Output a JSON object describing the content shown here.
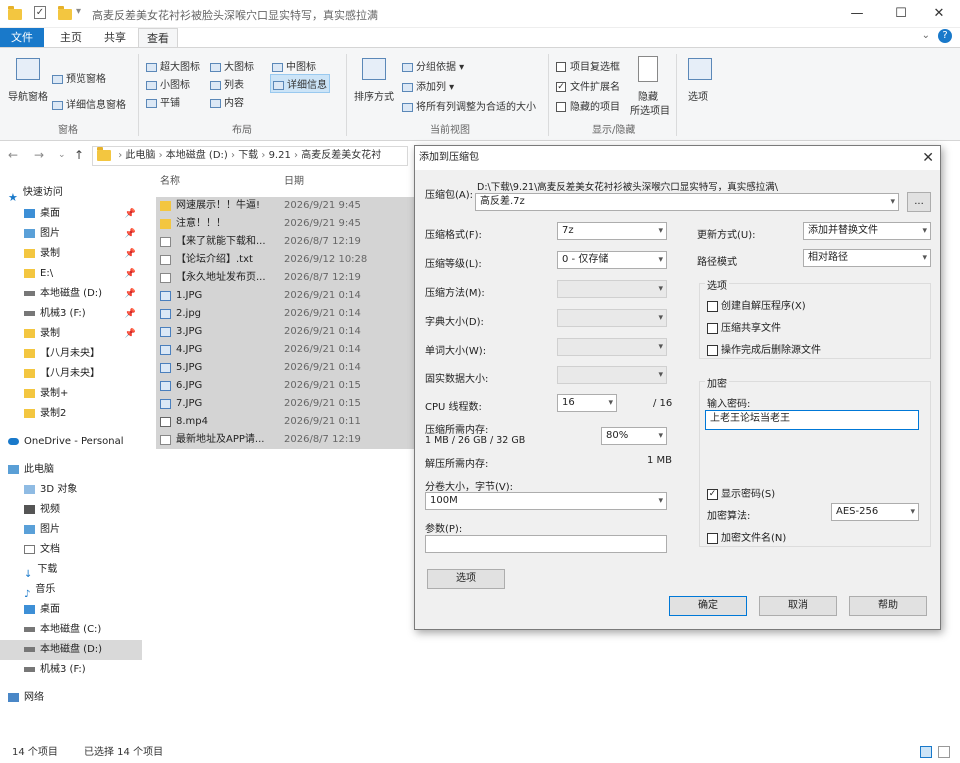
{
  "window": {
    "title": "高麦反差美女花衬衫被脸头深喉穴口显实特写，真实感拉满",
    "min": "—",
    "max": "☐",
    "close": "✕"
  },
  "ribbon_tabs": [
    "文件",
    "主页",
    "共享",
    "查看"
  ],
  "ribbon": {
    "nav_pane": "导航窗格",
    "preview_pane": "预览窗格",
    "details_pane": "详细信息窗格",
    "group_panes": "窗格",
    "layout": [
      "超大图标",
      "大图标",
      "中图标",
      "小图标",
      "列表",
      "详细信息",
      "平铺",
      "内容"
    ],
    "group_layout": "布局",
    "sort_by": "排序方式",
    "group_by": "分组依据",
    "add_columns": "添加列",
    "fit_columns": "将所有列调整为合适的大小",
    "group_current_view": "当前视图",
    "item_checkboxes": "项目复选框",
    "file_extensions": "文件扩展名",
    "hidden_items": "隐藏的项目",
    "hide": "隐藏",
    "hide_selected": "所选项目",
    "group_show_hide": "显示/隐藏",
    "options": "选项"
  },
  "address": {
    "crumbs": [
      "此电脑",
      "本地磁盘 (D:)",
      "下载",
      "9.21",
      "高麦反差美女花衬"
    ]
  },
  "nav_pane": {
    "items": [
      {
        "label": "快速访问",
        "pin": false
      },
      {
        "label": "桌面",
        "pin": true
      },
      {
        "label": "图片",
        "pin": true
      },
      {
        "label": "录制",
        "pin": true
      },
      {
        "label": "E:\\",
        "pin": true
      },
      {
        "label": "本地磁盘 (D:)",
        "pin": true
      },
      {
        "label": "机械3 (F:)",
        "pin": true
      },
      {
        "label": "录制",
        "pin": true
      },
      {
        "label": "【八月未央】",
        "pin": false
      },
      {
        "label": "【八月未央】",
        "pin": false
      },
      {
        "label": "录制+",
        "pin": false
      },
      {
        "label": "录制2",
        "pin": false
      },
      {
        "label": "OneDrive - Personal",
        "pin": false
      },
      {
        "label": "此电脑",
        "pin": false
      },
      {
        "label": "3D 对象",
        "pin": false
      },
      {
        "label": "视频",
        "pin": false
      },
      {
        "label": "图片",
        "pin": false
      },
      {
        "label": "文档",
        "pin": false
      },
      {
        "label": "下载",
        "pin": false
      },
      {
        "label": "音乐",
        "pin": false
      },
      {
        "label": "桌面",
        "pin": false
      },
      {
        "label": "本地磁盘 (C:)",
        "pin": false
      },
      {
        "label": "本地磁盘 (D:)",
        "pin": false
      },
      {
        "label": "机械3 (F:)",
        "pin": false
      },
      {
        "label": "网络",
        "pin": false
      }
    ]
  },
  "file_list": {
    "col_name": "名称",
    "col_date": "日期",
    "rows": [
      {
        "name": "网速展示！！牛逼!",
        "date": "2026/9/21 9:45",
        "type": "folder"
      },
      {
        "name": "注意！！！",
        "date": "2026/9/21 9:45",
        "type": "folder"
      },
      {
        "name": "【来了就能下载和...",
        "date": "2026/8/7 12:19",
        "type": "doc"
      },
      {
        "name": "【论坛介绍】.txt",
        "date": "2026/9/12 10:28",
        "type": "doc"
      },
      {
        "name": "【永久地址发布页...",
        "date": "2026/8/7 12:19",
        "type": "doc"
      },
      {
        "name": "1.JPG",
        "date": "2026/9/21 0:14",
        "type": "img"
      },
      {
        "name": "2.jpg",
        "date": "2026/9/21 0:14",
        "type": "img"
      },
      {
        "name": "3.JPG",
        "date": "2026/9/21 0:14",
        "type": "img"
      },
      {
        "name": "4.JPG",
        "date": "2026/9/21 0:14",
        "type": "img"
      },
      {
        "name": "5.JPG",
        "date": "2026/9/21 0:14",
        "type": "img"
      },
      {
        "name": "6.JPG",
        "date": "2026/9/21 0:15",
        "type": "img"
      },
      {
        "name": "7.JPG",
        "date": "2026/9/21 0:15",
        "type": "img"
      },
      {
        "name": "8.mp4",
        "date": "2026/9/21 0:11",
        "type": "vid"
      },
      {
        "name": "最新地址及APP请...",
        "date": "2026/8/7 12:19",
        "type": "doc"
      }
    ]
  },
  "status": {
    "count": "14 个项目",
    "selected": "已选择 14 个项目"
  },
  "dialog": {
    "title": "添加到压缩包",
    "close": "✕",
    "archive_label": "压缩包(A):",
    "archive_path": "D:\\下载\\9.21\\高麦反差美女花衬衫被头深喉穴口显实特写，真实感拉满\\",
    "archive_name": "高反差.7z",
    "browse": "...",
    "format_label": "压缩格式(F):",
    "format_value": "7z",
    "level_label": "压缩等级(L):",
    "level_value": "0 - 仅存储",
    "method_label": "压缩方法(M):",
    "dict_label": "字典大小(D):",
    "word_label": "单词大小(W):",
    "solid_label": "固实数据大小:",
    "cpu_label": "CPU 线程数:",
    "cpu_value": "16",
    "cpu_total": "/ 16",
    "mem_comp_label": "压缩所需内存:",
    "mem_comp_value": "1 MB / 26 GB / 32 GB",
    "mem_pct": "80%",
    "mem_decomp_label": "解压所需内存:",
    "mem_decomp_value": "1 MB",
    "volume_label": "分卷大小，字节(V):",
    "volume_value": "100M",
    "params_label": "参数(P):",
    "params_value": "",
    "options_btn": "选项",
    "update_label": "更新方式(U):",
    "update_value": "添加并替换文件",
    "path_label": "路径模式",
    "path_value": "相对路径",
    "options_group": "选项",
    "opt_sfx": "创建自解压程序(X)",
    "opt_shared": "压缩共享文件",
    "opt_delete": "操作完成后删除源文件",
    "encrypt_group": "加密",
    "password_label": "输入密码:",
    "password_value": "上老王论坛当老王",
    "show_pw": "显示密码(S)",
    "enc_method_label": "加密算法:",
    "enc_method_value": "AES-256",
    "enc_names": "加密文件名(N)",
    "ok": "确定",
    "cancel": "取消",
    "help": "帮助"
  }
}
